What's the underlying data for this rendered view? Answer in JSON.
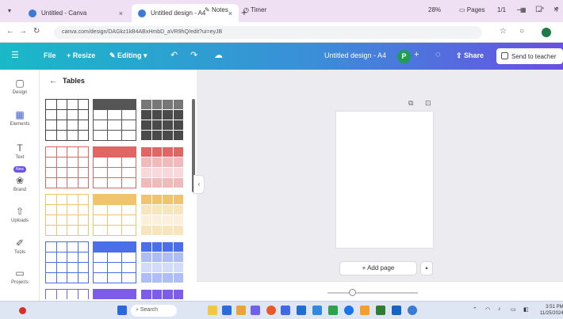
{
  "browser": {
    "tabs": [
      {
        "title": "Untitled - Canva"
      },
      {
        "title": "Untitled design - A4"
      }
    ],
    "url": "canva.com/design/DAGkz1kB4ABxHmbD_aVR9hQ/edit?ui=eyJB"
  },
  "header": {
    "file_label": "File",
    "resize_label": "Resize",
    "editing_label": "Editing",
    "doc_title": "Untitled design - A4",
    "avatar_letter": "P",
    "share_label": "Share",
    "send_label": "Send to teacher"
  },
  "rail": {
    "items": [
      {
        "label": "Design",
        "icon": "layout-icon"
      },
      {
        "label": "Elements",
        "icon": "shapes-icon"
      },
      {
        "label": "Text",
        "icon": "text-icon"
      },
      {
        "label": "Brand",
        "icon": "brand-icon"
      },
      {
        "label": "Uploads",
        "icon": "upload-icon"
      },
      {
        "label": "Tools",
        "icon": "tools-icon"
      },
      {
        "label": "Projects",
        "icon": "folder-icon"
      }
    ],
    "new_badge": "New"
  },
  "panel": {
    "title": "Tables"
  },
  "table_styles": [
    {
      "row": 0,
      "col": 0,
      "variant": "outline",
      "color": "#444444"
    },
    {
      "row": 0,
      "col": 1,
      "variant": "header",
      "color": "#555555"
    },
    {
      "row": 0,
      "col": 2,
      "variant": "filled",
      "color": "#555555"
    },
    {
      "row": 1,
      "col": 0,
      "variant": "outline",
      "color": "#e06666"
    },
    {
      "row": 1,
      "col": 1,
      "variant": "header",
      "color": "#e06666"
    },
    {
      "row": 1,
      "col": 2,
      "variant": "filled",
      "color": "#e06666"
    },
    {
      "row": 2,
      "col": 0,
      "variant": "outline",
      "color": "#f0c36d"
    },
    {
      "row": 2,
      "col": 1,
      "variant": "header",
      "color": "#f0c36d"
    },
    {
      "row": 2,
      "col": 2,
      "variant": "filled",
      "color": "#f0c36d"
    },
    {
      "row": 3,
      "col": 0,
      "variant": "outline",
      "color": "#4a6fe8"
    },
    {
      "row": 3,
      "col": 1,
      "variant": "header",
      "color": "#4a6fe8"
    },
    {
      "row": 3,
      "col": 2,
      "variant": "filled",
      "color": "#4a6fe8"
    },
    {
      "row": 4,
      "col": 0,
      "variant": "outline",
      "color": "#7c5ce8"
    },
    {
      "row": 4,
      "col": 1,
      "variant": "header",
      "color": "#7c5ce8"
    },
    {
      "row": 4,
      "col": 2,
      "variant": "filled",
      "color": "#7c5ce8"
    }
  ],
  "canvas": {
    "add_page_label": "+ Add page"
  },
  "bottom": {
    "notes_label": "Notes",
    "timer_label": "Timer",
    "zoom_value": "28%",
    "zoom_fraction": 0.28,
    "pages_label": "Pages",
    "page_count": "1/1"
  },
  "taskbar": {
    "search_placeholder": "Search",
    "clock_time": "3:51 PM",
    "clock_date": "11/25/2024"
  }
}
